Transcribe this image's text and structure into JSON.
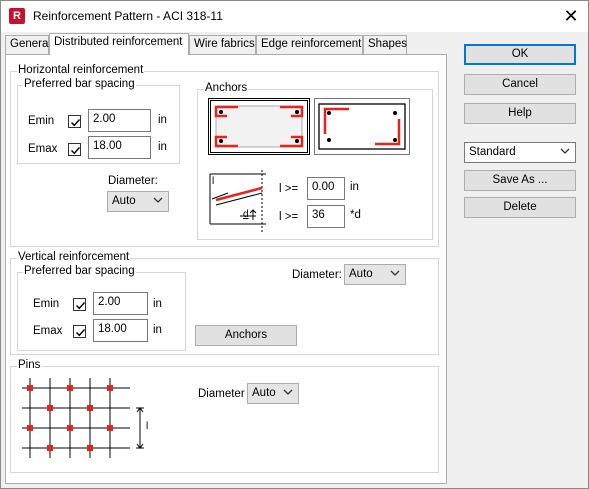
{
  "window": {
    "title": "Reinforcement Pattern - ACI 318-11",
    "app_icon_letter": "R",
    "close_glyph": "✕"
  },
  "tabs": [
    {
      "label": "General",
      "active": false
    },
    {
      "label": "Distributed reinforcement",
      "active": true
    },
    {
      "label": "Wire fabrics",
      "active": false
    },
    {
      "label": "Edge reinforcement",
      "active": false
    },
    {
      "label": "Shapes",
      "active": false
    }
  ],
  "horizontal": {
    "title": "Horizontal reinforcement",
    "spacing_title": "Preferred bar spacing",
    "emin_label": "Emin",
    "emin_checked": true,
    "emin_value": "2.00",
    "emin_unit": "in",
    "emax_label": "Emax",
    "emax_checked": true,
    "emax_value": "18.00",
    "emax_unit": "in",
    "diameter_label": "Diameter:",
    "diameter_value": "Auto"
  },
  "anchors": {
    "title": "Anchors",
    "l_min_label": "l >=",
    "l_min_value": "0.00",
    "l_min_unit": "in",
    "l_factor_label": "l >=",
    "l_factor_value": "36",
    "l_factor_unit": "*d",
    "diagram_l": "l",
    "diagram_d": "d"
  },
  "vertical": {
    "title": "Vertical reinforcement",
    "spacing_title": "Preferred bar spacing",
    "emin_label": "Emin",
    "emin_checked": true,
    "emin_value": "2.00",
    "emin_unit": "in",
    "emax_label": "Emax",
    "emax_checked": true,
    "emax_value": "18.00",
    "emax_unit": "in",
    "diameter_label": "Diameter:",
    "diameter_value": "Auto",
    "anchors_button": "Anchors"
  },
  "pins": {
    "title": "Pins",
    "diameter_label": "Diameter",
    "diameter_value": "Auto",
    "diagram_l": "l"
  },
  "side": {
    "ok": "OK",
    "cancel": "Cancel",
    "help": "Help",
    "preset_value": "Standard",
    "save_as": "Save As ...",
    "delete": "Delete"
  },
  "colors": {
    "accent": "#0078d7",
    "rebar_red": "#e8231a",
    "brand": "#c8102e"
  }
}
